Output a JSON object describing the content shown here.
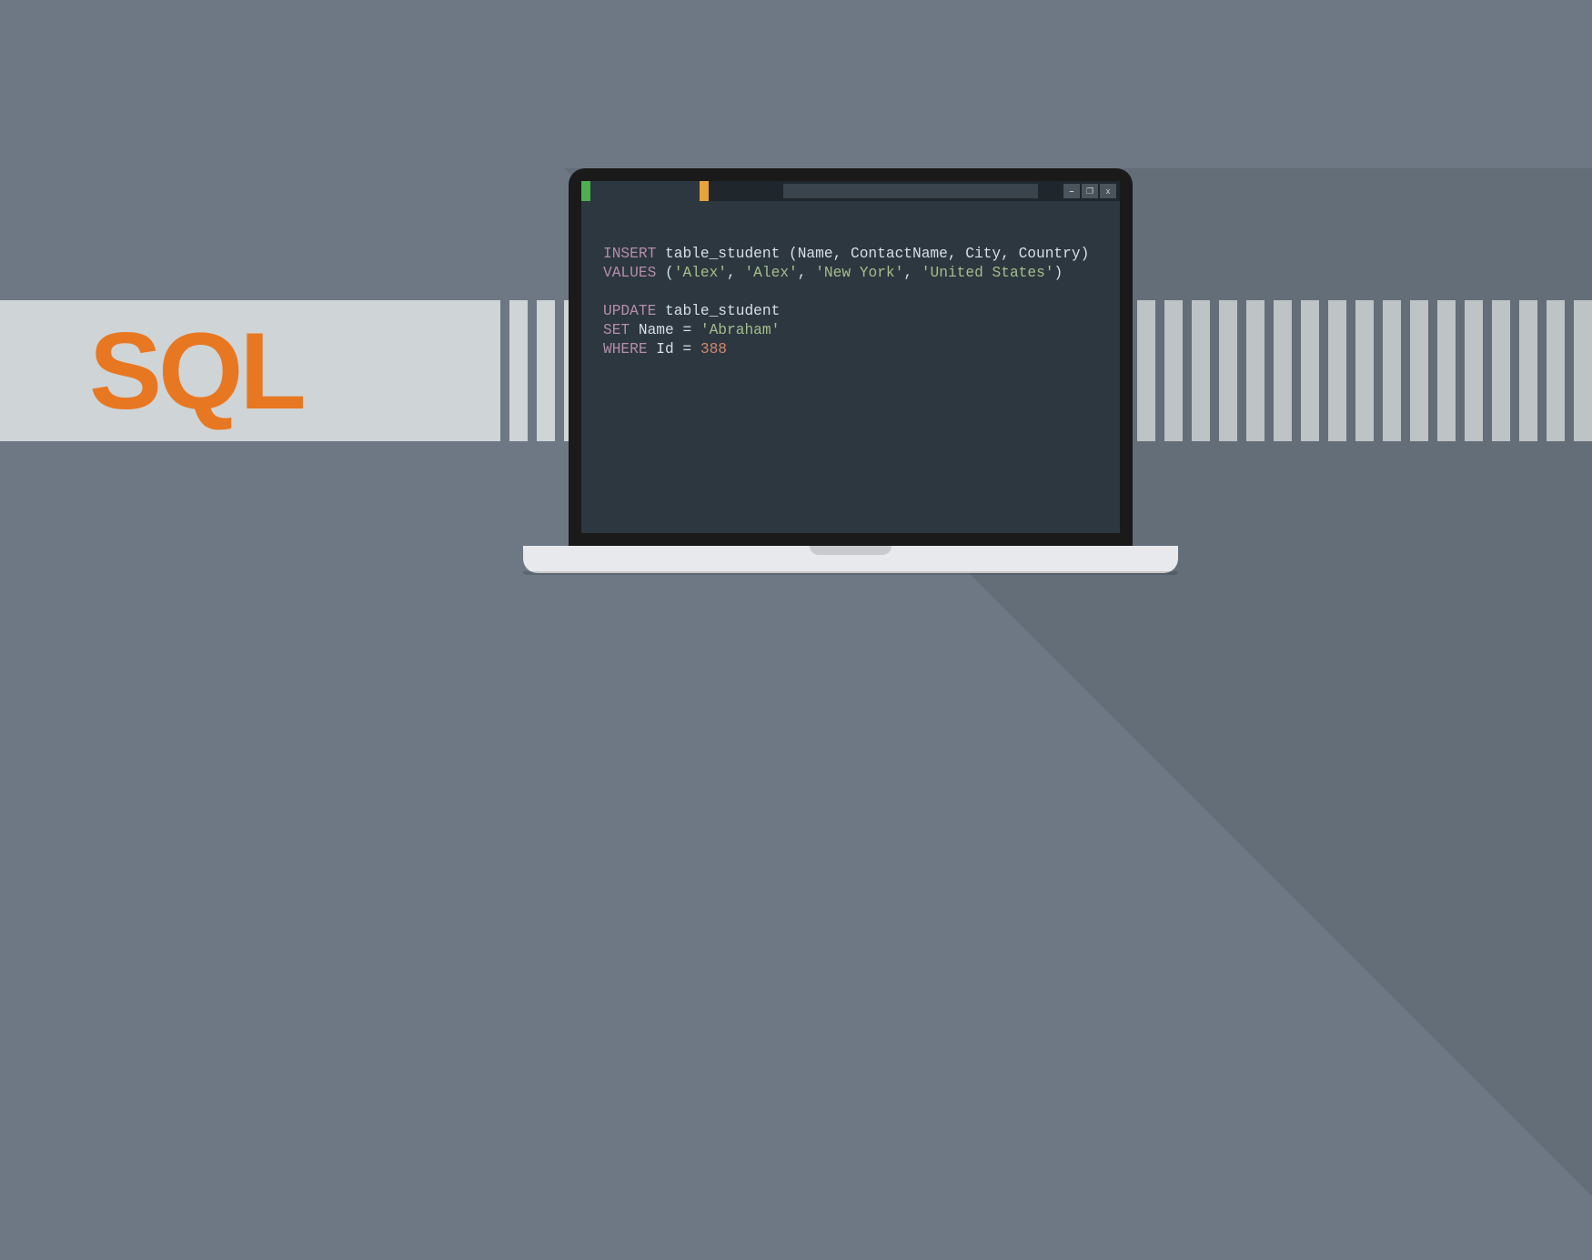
{
  "band": {
    "label": "SQL"
  },
  "window_controls": {
    "min": "–",
    "max": "❐",
    "close": "x"
  },
  "code": {
    "l1_kw": "INSERT",
    "l1_rest": " table_student (Name, ContactName, City, Country)",
    "l2_kw": "VALUES",
    "l2_a": " (",
    "l2_s1": "'Alex'",
    "l2_c1": ", ",
    "l2_s2": "'Alex'",
    "l2_c2": ", ",
    "l2_s3": "'New York'",
    "l2_c3": ", ",
    "l2_s4": "'United States'",
    "l2_b": ")",
    "l4_kw": "UPDATE",
    "l4_rest": " table_student",
    "l5_kw": "SET",
    "l5_a": " Name = ",
    "l5_s1": "'Abraham'",
    "l6_kw": "WHERE",
    "l6_a": " Id = ",
    "l6_n": "388"
  }
}
